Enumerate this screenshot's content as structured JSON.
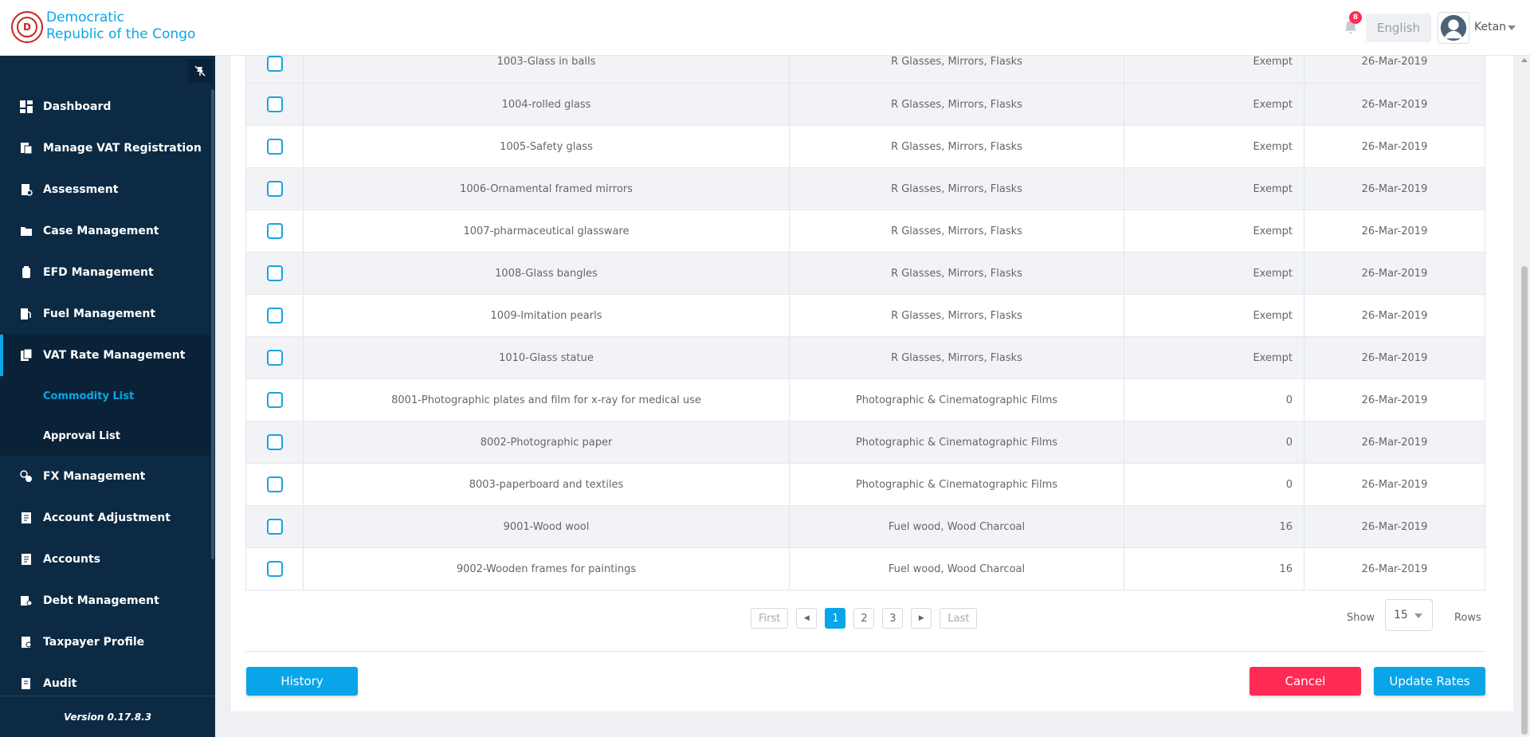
{
  "header": {
    "brand_line1": "Democratic",
    "brand_line2": "Republic of the Congo",
    "notification_count": "8",
    "language": "English",
    "user_name": "Ketan"
  },
  "sidebar": {
    "items": [
      {
        "label": "Dashboard",
        "icon": "dashboard-icon"
      },
      {
        "label": "Manage VAT Registration",
        "icon": "registration-icon"
      },
      {
        "label": "Assessment",
        "icon": "assessment-icon"
      },
      {
        "label": "Case Management",
        "icon": "folder-icon"
      },
      {
        "label": "EFD Management",
        "icon": "device-icon"
      },
      {
        "label": "Fuel Management",
        "icon": "fuel-icon"
      },
      {
        "label": "VAT Rate Management",
        "icon": "rate-icon"
      },
      {
        "label": "FX Management",
        "icon": "fx-icon"
      },
      {
        "label": "Account Adjustment",
        "icon": "document-icon"
      },
      {
        "label": "Accounts",
        "icon": "document-icon"
      },
      {
        "label": "Debt Management",
        "icon": "debt-icon"
      },
      {
        "label": "Taxpayer Profile",
        "icon": "profile-icon"
      },
      {
        "label": "Audit",
        "icon": "audit-icon"
      }
    ],
    "sub_items": [
      "Commodity List",
      "Approval List"
    ],
    "version": "Version 0.17.8.3"
  },
  "table": {
    "rows": [
      {
        "name": "1003-Glass in balls",
        "category": "R Glasses, Mirrors, Flasks",
        "rate": "Exempt",
        "date": "26-Mar-2019"
      },
      {
        "name": "1004-rolled glass",
        "category": "R Glasses, Mirrors, Flasks",
        "rate": "Exempt",
        "date": "26-Mar-2019"
      },
      {
        "name": "1005-Safety glass",
        "category": "R Glasses, Mirrors, Flasks",
        "rate": "Exempt",
        "date": "26-Mar-2019"
      },
      {
        "name": "1006-Ornamental framed mirrors",
        "category": "R Glasses, Mirrors, Flasks",
        "rate": "Exempt",
        "date": "26-Mar-2019"
      },
      {
        "name": "1007-pharmaceutical glassware",
        "category": "R Glasses, Mirrors, Flasks",
        "rate": "Exempt",
        "date": "26-Mar-2019"
      },
      {
        "name": "1008-Glass bangles",
        "category": "R Glasses, Mirrors, Flasks",
        "rate": "Exempt",
        "date": "26-Mar-2019"
      },
      {
        "name": "1009-Imitation pearls",
        "category": "R Glasses, Mirrors, Flasks",
        "rate": "Exempt",
        "date": "26-Mar-2019"
      },
      {
        "name": "1010-Glass statue",
        "category": "R Glasses, Mirrors, Flasks",
        "rate": "Exempt",
        "date": "26-Mar-2019"
      },
      {
        "name": "8001-Photographic plates and film for x-ray for medical use",
        "category": "Photographic & Cinematographic Films",
        "rate": "0",
        "date": "26-Mar-2019"
      },
      {
        "name": "8002-Photographic paper",
        "category": "Photographic & Cinematographic Films",
        "rate": "0",
        "date": "26-Mar-2019"
      },
      {
        "name": "8003-paperboard and textiles",
        "category": "Photographic & Cinematographic Films",
        "rate": "0",
        "date": "26-Mar-2019"
      },
      {
        "name": "9001-Wood wool",
        "category": "Fuel wood, Wood Charcoal",
        "rate": "16",
        "date": "26-Mar-2019"
      },
      {
        "name": "9002-Wooden frames for paintings",
        "category": "Fuel wood, Wood Charcoal",
        "rate": "16",
        "date": "26-Mar-2019"
      }
    ]
  },
  "pagination": {
    "first": "First",
    "last": "Last",
    "pages": [
      "1",
      "2",
      "3"
    ],
    "current": "1",
    "show_label": "Show",
    "rows_per_page": "15",
    "rows_label": "Rows"
  },
  "actions": {
    "history": "History",
    "cancel": "Cancel",
    "update": "Update Rates"
  },
  "colors": {
    "accent": "#0aa5e8",
    "danger": "#ff2b55",
    "sidebar_bg": "#0c2a44"
  }
}
